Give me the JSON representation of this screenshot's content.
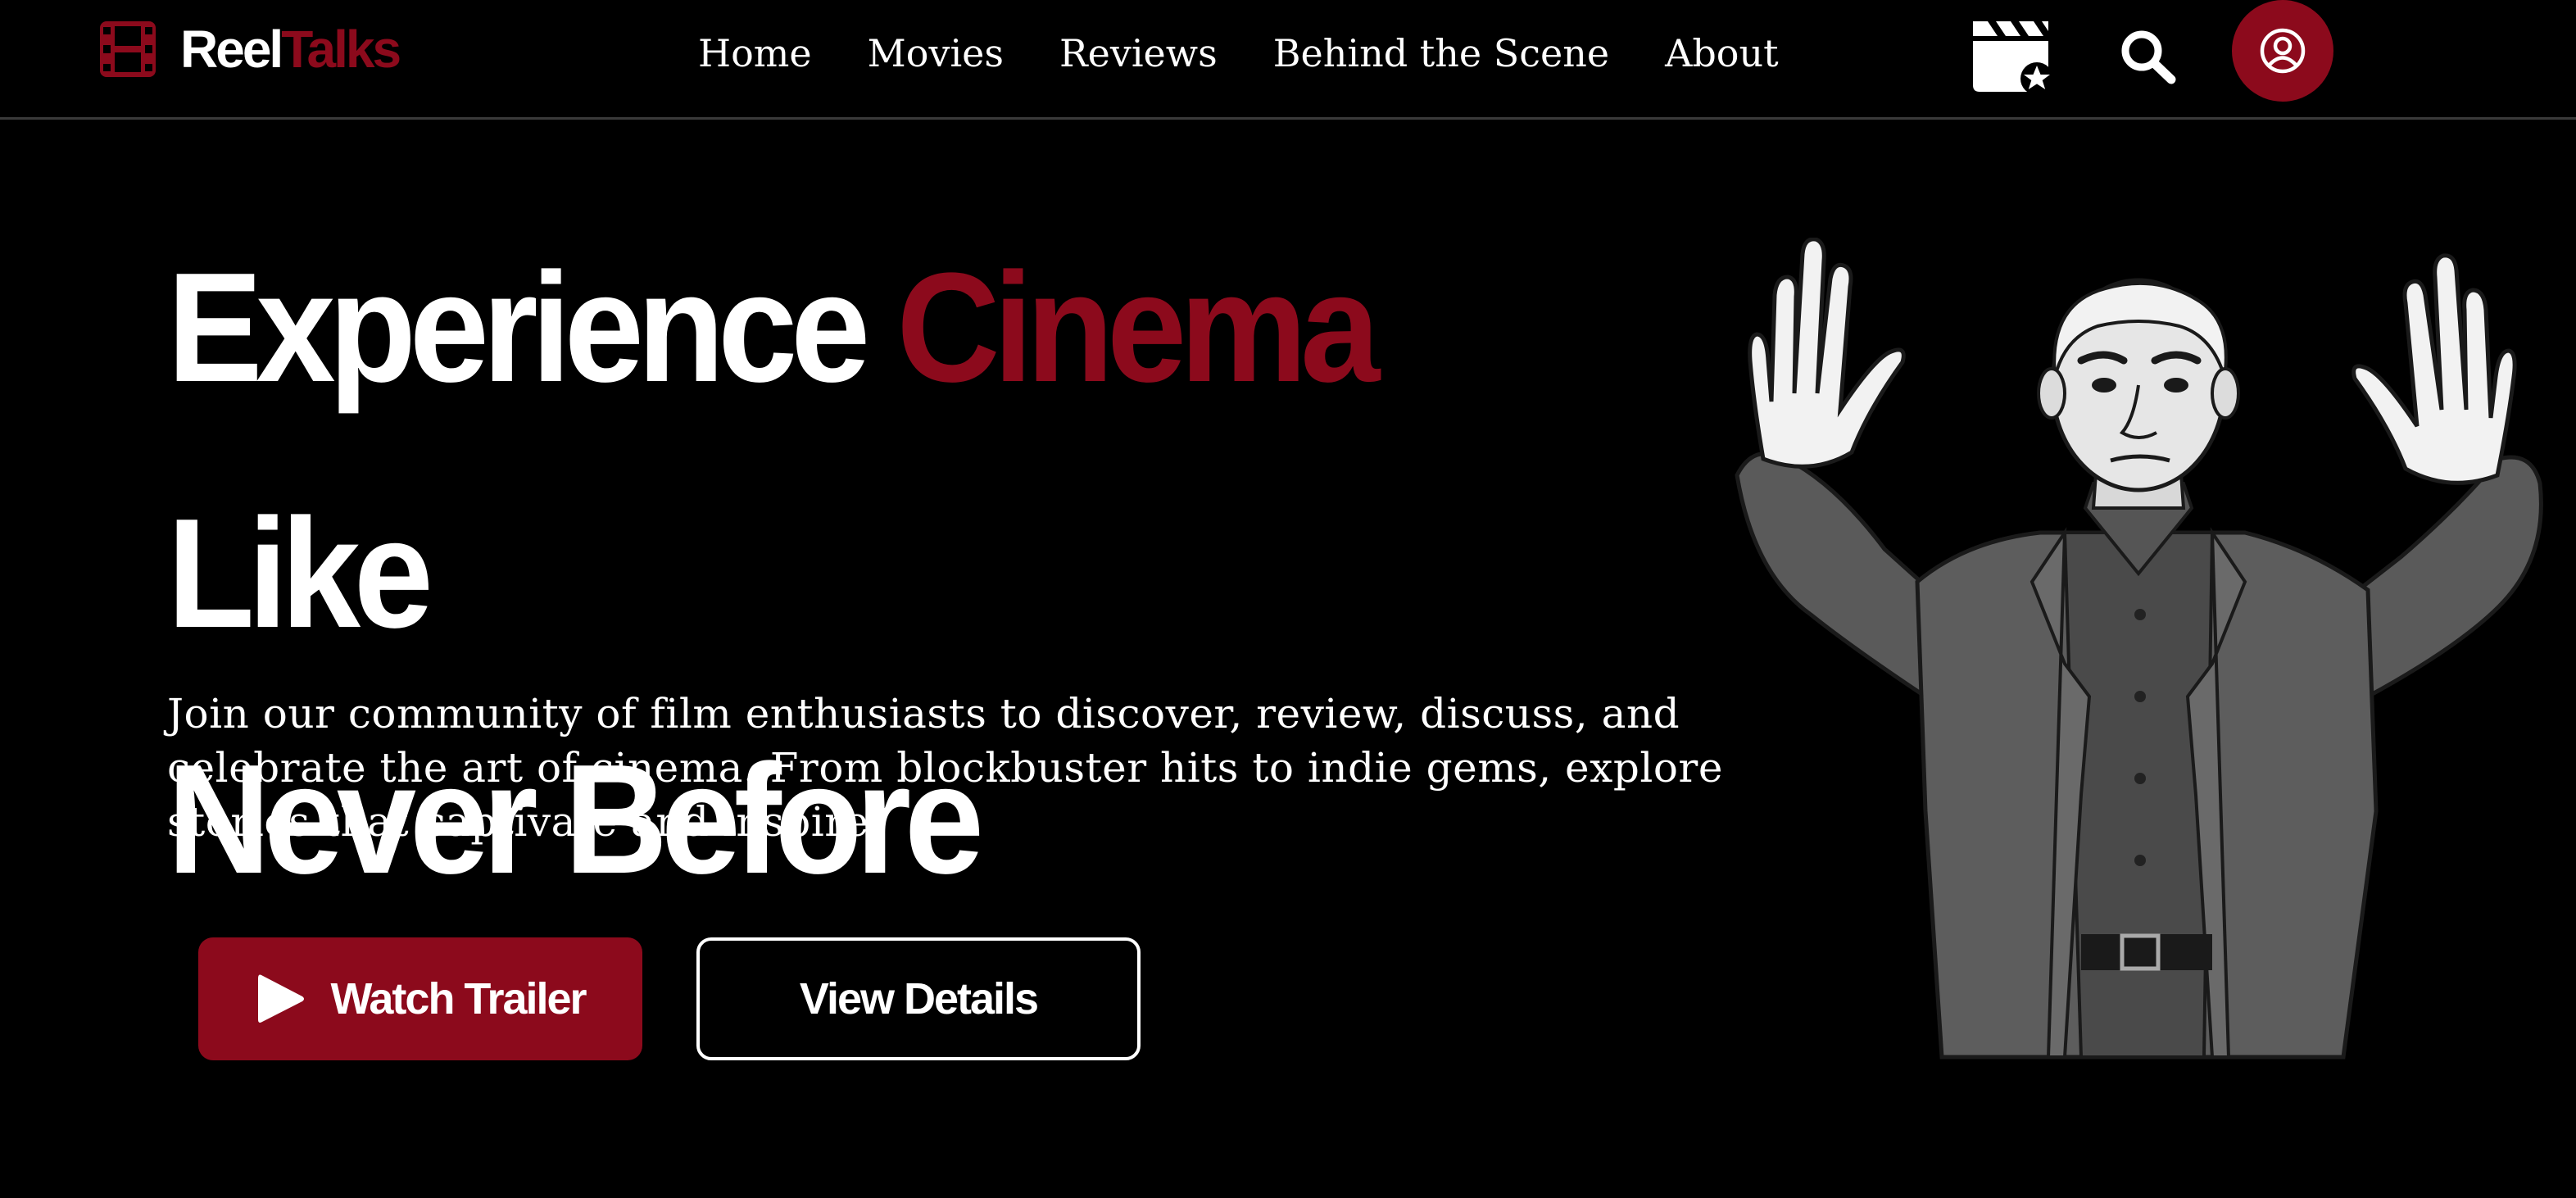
{
  "brand": {
    "name_part1": "Reel",
    "name_part2": "Talks",
    "accent_color": "#8c0a1c"
  },
  "nav": {
    "links": [
      {
        "label": "Home"
      },
      {
        "label": "Movies"
      },
      {
        "label": "Reviews"
      },
      {
        "label": "Behind the Scene"
      },
      {
        "label": "About"
      }
    ],
    "icons": [
      "film-clapperboard-star-icon",
      "search-icon",
      "user-profile-icon"
    ]
  },
  "hero": {
    "title_part1": "Experience",
    "title_accent": "Cinema",
    "title_part2": "Like",
    "title_line2": "Never Before",
    "description": "Join our community of film enthusiasts to discover, review, discuss, and celebrate the art of cinema. From blockbuster hits to indie gems, explore stories that captivate and inspire.",
    "primary_button": "Watch Trailer",
    "secondary_button": "View Details",
    "illustration": "man-in-suit-hands-raised-illustration"
  }
}
